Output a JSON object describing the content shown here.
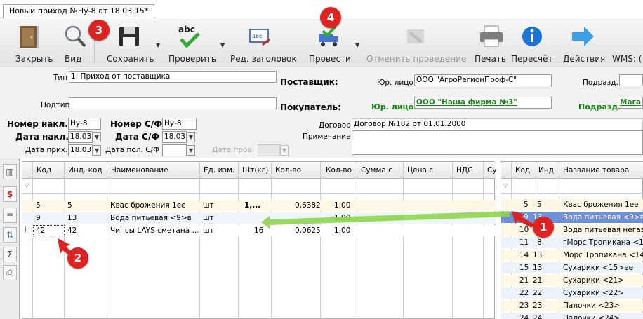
{
  "window": {
    "tab_title": "Новый приход №Ну-8 от 18.03.15*"
  },
  "toolbar": {
    "close": "Закрыть",
    "view": "Вид",
    "save": "Сохранить",
    "check": "Проверить",
    "edit_header": "Ред. заголовок",
    "post": "Провести",
    "unpost": "Отменить проведение",
    "print": "Печать",
    "recalc": "Пересчёт",
    "actions": "Действия",
    "wms": "WMS: ("
  },
  "form": {
    "type_label": "Тип",
    "type_value": "1: Приход от поставщика",
    "subtype_label": "Подтип",
    "supplier_label": "Поставщик:",
    "buyer_label": "Покупатель:",
    "legal_label": "Юр. лицо",
    "supplier_legal": "ООО \"АгроРегионПроф-С\"",
    "buyer_legal": "ООО \"Наша фирма №3\"",
    "subdiv_label": "Подразд.",
    "buyer_subdiv": "Мага",
    "invoice_no_label": "Номер накл.",
    "invoice_no": "Ну-8",
    "sf_no_label": "Номер С/Ф",
    "sf_no": "Ну-8",
    "invoice_date_label": "Дата накл.",
    "invoice_date": "18.03",
    "sf_date_label": "Дата С/Ф",
    "sf_date": "18.03",
    "arrival_date_label": "Дата прих.",
    "arrival_date": "18.03",
    "sf_received_label": "Дата пол. С/Ф",
    "check_date_label": "Дата пров.",
    "contract_label": "Договор",
    "contract_value": "Договор №182 от 01.01.2000",
    "note_label": "Примечание"
  },
  "left_grid": {
    "columns": [
      "Код",
      "Инд. код",
      "Наименование",
      "Ед. изм.",
      "Шт(кг)",
      "Кол-во",
      "Кол-во",
      "Сумма с",
      "Цена с",
      "НДС",
      "Су"
    ],
    "rows": [
      {
        "code": "5",
        "ind": "5",
        "name": "Квас брожения 1ее",
        "unit": "шт",
        "pcs": "1,...",
        "q1": "0,6382",
        "q2": "1,00"
      },
      {
        "code": "9",
        "ind": "13",
        "name": "Вода питьевая  <9>в",
        "unit": "шт",
        "pcs": "",
        "q1": "",
        "q2": "1,00"
      },
      {
        "code": "42",
        "ind": "42",
        "name": "Чипсы LAYS сметана ...",
        "unit": "шт",
        "pcs": "16",
        "q1": "0,0625",
        "q2": "1,00"
      }
    ]
  },
  "right_grid": {
    "columns": [
      "Код",
      "Инд.",
      "Название товара"
    ],
    "rows": [
      {
        "code": "5",
        "ind": "5",
        "name": "Квас брожения 1ее"
      },
      {
        "code": "9",
        "ind": "13",
        "name": "Вода питьевая  <9>в"
      },
      {
        "code": "10",
        "ind": "8",
        "name": "Вода питьевая негаз"
      },
      {
        "code": "11",
        "ind": "8",
        "name": "гМорс Тропикана  <1"
      },
      {
        "code": "14",
        "ind": "13",
        "name": "Морс Тропикана  <14"
      },
      {
        "code": "15",
        "ind": "13",
        "name": "Сухарики  <15>ее"
      },
      {
        "code": "21",
        "ind": "21",
        "name": "Сухарики  <21>"
      },
      {
        "code": "22",
        "ind": "22",
        "name": "Сухарики  <22>"
      },
      {
        "code": "23",
        "ind": "23",
        "name": "Палочки  <23>"
      },
      {
        "code": "24",
        "ind": "24",
        "name": "Палочки  <24>"
      }
    ]
  },
  "annotations": {
    "b1": "1",
    "b2": "2",
    "b3": "3",
    "b4": "4"
  },
  "colors": {
    "accent": "#dd2222",
    "arrow": "#7fd040",
    "selected_row": "#6f8fd6"
  }
}
